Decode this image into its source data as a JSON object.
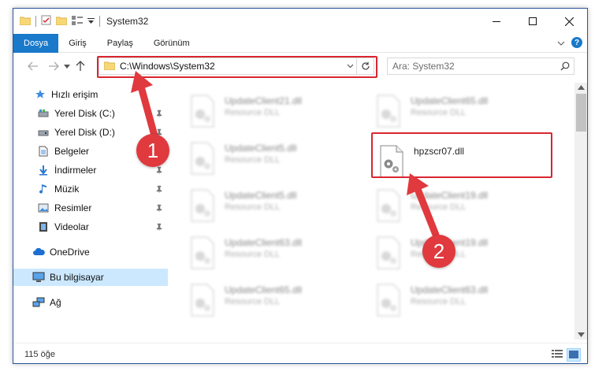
{
  "window": {
    "title": "System32"
  },
  "ribbon": {
    "tabs": [
      {
        "label": "Dosya",
        "active": true
      },
      {
        "label": "Giriş",
        "active": false
      },
      {
        "label": "Paylaş",
        "active": false
      },
      {
        "label": "Görünüm",
        "active": false
      }
    ],
    "help_glyph": "?"
  },
  "address_bar": {
    "path": "C:\\Windows\\System32"
  },
  "search": {
    "placeholder": "Ara: System32"
  },
  "nav_pane": {
    "items": [
      {
        "label": "Hızlı erişim",
        "icon": "star-icon"
      },
      {
        "label": "Yerel Disk (C:)",
        "icon": "drive-icon"
      },
      {
        "label": "Yerel Disk (D:)",
        "icon": "drive-icon"
      },
      {
        "label": "Belgeler",
        "icon": "documents-icon"
      },
      {
        "label": "İndirmeler",
        "icon": "download-icon"
      },
      {
        "label": "Müzik",
        "icon": "music-icon"
      },
      {
        "label": "Resimler",
        "icon": "pictures-icon"
      },
      {
        "label": "Videolar",
        "icon": "video-icon"
      },
      {
        "label": "OneDrive",
        "icon": "cloud-icon"
      },
      {
        "label": "Bu bilgisayar",
        "icon": "computer-icon"
      },
      {
        "label": "Ağ",
        "icon": "network-icon"
      }
    ]
  },
  "files": [
    {
      "name": "UpdateClient21.dll",
      "type": "Resource DLL"
    },
    {
      "name": "UpdateClient65.dll",
      "type": "Resource DLL"
    },
    {
      "name": "UpdateClient5.dll",
      "type": "Resource DLL"
    },
    {
      "name": "hpzscr07.dll",
      "type": ""
    },
    {
      "name": "UpdateClient5.dll",
      "type": "Resource DLL"
    },
    {
      "name": "UpdateClient19.dll",
      "type": "Resource DLL"
    },
    {
      "name": "UpdateClient63.dll",
      "type": "Resource DLL"
    },
    {
      "name": "UpdateClient19.dll",
      "type": "Resource DLL"
    },
    {
      "name": "UpdateClient65.dll",
      "type": "Resource DLL"
    },
    {
      "name": "UpdateClient63.dll",
      "type": "Resource DLL"
    }
  ],
  "status_bar": {
    "item_count": "115 öğe"
  },
  "annotations": {
    "step1": "1",
    "step2": "2",
    "color": "#e0393e"
  },
  "colors": {
    "accent": "#1979ca",
    "selected": "#cce8ff",
    "highlight": "#d9262f"
  }
}
